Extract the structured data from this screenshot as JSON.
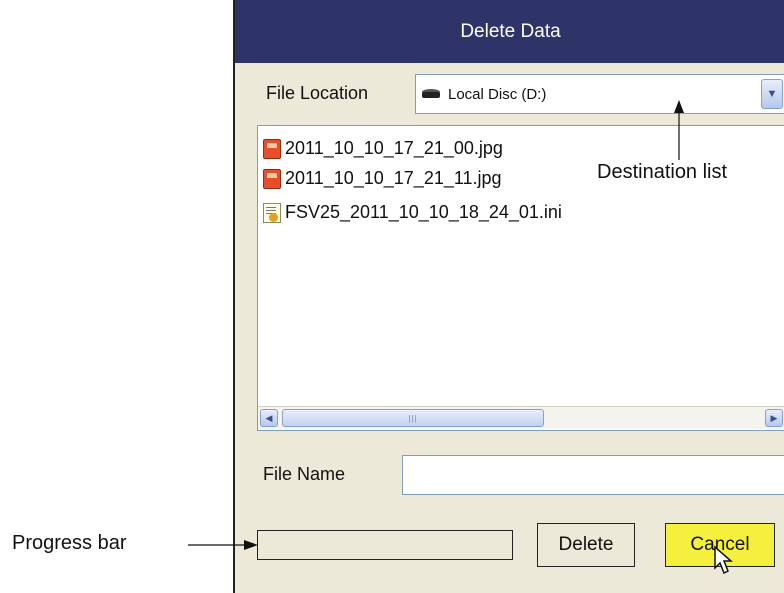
{
  "dialog": {
    "title": "Delete Data",
    "file_location_label": "File Location",
    "file_location_value": "Local Disc (D:)",
    "files": [
      {
        "name": "2011_10_10_17_21_00.jpg",
        "icon": "image-file-icon"
      },
      {
        "name": "2011_10_10_17_21_11.jpg",
        "icon": "image-file-icon"
      },
      {
        "name": "FSV25_2011_10_10_18_24_01.ini",
        "icon": "ini-file-icon"
      }
    ],
    "file_name_label": "File Name",
    "file_name_value": "",
    "delete_label": "Delete",
    "cancel_label": "Cancel"
  },
  "annotations": {
    "destination_list": "Destination list",
    "progress_bar": "Progress bar"
  },
  "colors": {
    "titlebar": "#2f3468",
    "dialog_background": "#ece9d8",
    "cancel_highlight": "#f5f03e"
  },
  "icons": [
    "drive-icon",
    "dropdown-arrow-icon",
    "scroll-left-icon",
    "scroll-right-icon",
    "mouse-pointer-icon"
  ]
}
